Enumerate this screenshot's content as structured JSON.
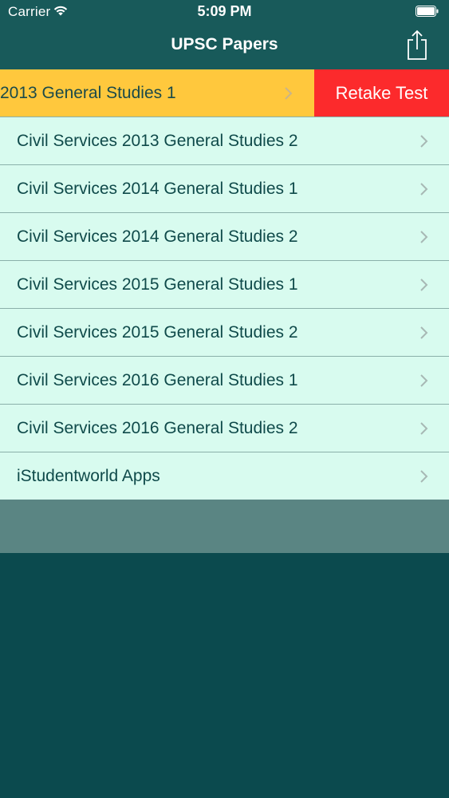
{
  "status_bar": {
    "carrier": "Carrier",
    "time": "5:09 PM",
    "wifi_icon": "wifi-icon",
    "battery_icon": "battery-icon"
  },
  "nav": {
    "title": "UPSC Papers",
    "share_icon": "share-icon"
  },
  "list": {
    "swiped_row": {
      "label": "2013 General Studies 1",
      "action_label": "Retake Test"
    },
    "items": [
      "Civil Services 2013 General Studies 2",
      "Civil Services 2014 General Studies 1",
      "Civil Services 2014 General Studies 2",
      "Civil Services 2015 General Studies 1",
      "Civil Services 2015 General Studies 2",
      "Civil Services 2016 General Studies 1",
      "Civil Services 2016 General Studies 2",
      "iStudentworld Apps"
    ]
  },
  "colors": {
    "header_bg": "#185a5a",
    "row_bg": "#d8fbef",
    "swiped_row_bg": "#ffc83d",
    "action_bg": "#fc2a2c",
    "page_bg": "#0b4a4e"
  }
}
